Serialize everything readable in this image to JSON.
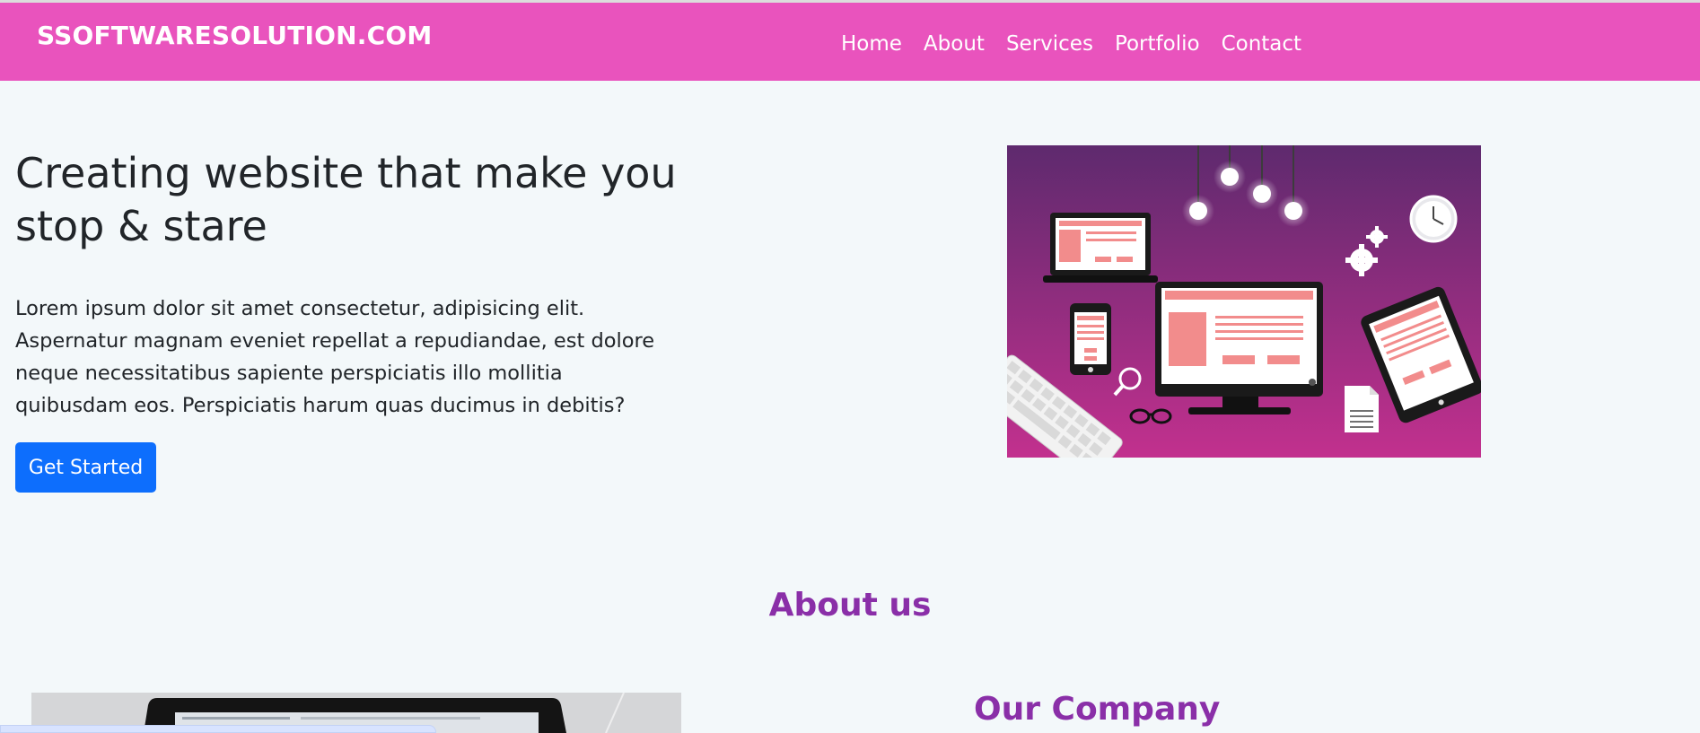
{
  "navbar": {
    "brand": "SSOFTWARESOLUTION.COM",
    "links": [
      {
        "label": "Home"
      },
      {
        "label": "About"
      },
      {
        "label": "Services"
      },
      {
        "label": "Portfolio"
      },
      {
        "label": "Contact"
      }
    ],
    "background": "#e953bd"
  },
  "hero": {
    "title": "Creating website that make you stop & stare",
    "description": "Lorem ipsum dolor sit amet consectetur, adipisicing elit. Aspernatur magnam eveniet repellat a repudiandae, est dolore neque necessitatibus sapiente perspiciatis illo mollitia quibusdam eos. Perspiciatis harum quas ducimus in debitis?",
    "button_label": "Get Started",
    "button_color": "#0d6efd"
  },
  "about": {
    "heading": "About us",
    "company_heading": "Our Company",
    "heading_color": "#8a2fa8"
  }
}
